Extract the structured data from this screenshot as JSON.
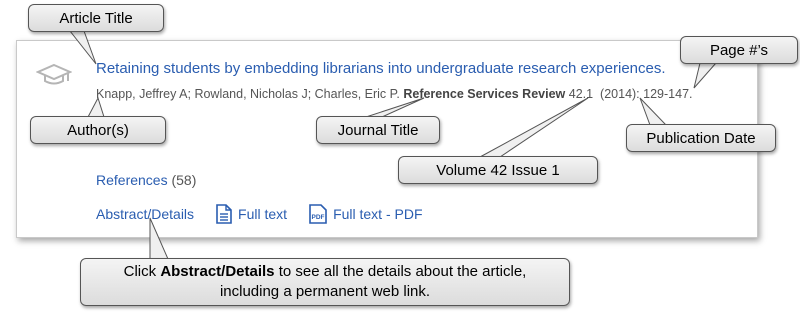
{
  "result": {
    "title": "Retaining students by embedding librarians into undergraduate research experiences.",
    "authors": "Knapp, Jeffrey A; Rowland, Nicholas J; Charles, Eric P.",
    "journal": "Reference Services Review",
    "volume_issue": "42.1",
    "year": "(2014):",
    "pages": "129-147.",
    "references_label": "References",
    "references_count": "(58)",
    "abstract_link": "Abstract/Details",
    "fulltext_link": "Full text",
    "fulltext_pdf_link": "Full text - PDF"
  },
  "callouts": {
    "article_title": "Article Title",
    "page_numbers": "Page #’s",
    "authors": "Author(s)",
    "journal_title": "Journal Title",
    "publication_date": "Publication Date",
    "volume_issue": "Volume 42 Issue 1",
    "click_bold": "Abstract/Details",
    "click_prefix": "Click ",
    "click_suffix": " to see all the details about the article,",
    "click_line2": "including a permanent web link."
  },
  "colors": {
    "link": "#2a5db0",
    "callout_fill": "#e8e8e8"
  },
  "icons": [
    "graduation-cap-icon",
    "document-icon",
    "pdf-icon"
  ]
}
